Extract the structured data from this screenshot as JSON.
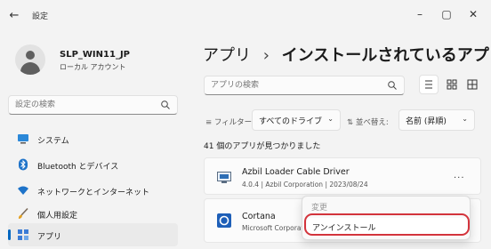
{
  "window": {
    "title": "設定",
    "controls": {
      "minimize": "–",
      "maximize": "▢",
      "close": "✕"
    },
    "back_glyph": "←"
  },
  "profile": {
    "name": "SLP_WIN11_JP",
    "account_type": "ローカル アカウント"
  },
  "sidebar": {
    "search_placeholder": "設定の検索",
    "items": [
      {
        "label": "システム",
        "icon": "monitor-icon"
      },
      {
        "label": "Bluetooth とデバイス",
        "icon": "bluetooth-icon"
      },
      {
        "label": "ネットワークとインターネット",
        "icon": "wifi-icon"
      },
      {
        "label": "個人用設定",
        "icon": "brush-icon"
      },
      {
        "label": "アプリ",
        "icon": "apps-icon",
        "active": true
      }
    ]
  },
  "main": {
    "breadcrumb": {
      "parent": "アプリ",
      "separator": "›",
      "current": "インストールされているアプリ"
    },
    "search_placeholder": "アプリの検索",
    "filter": {
      "label": "フィルター:",
      "value": "すべてのドライブ"
    },
    "sort": {
      "label": "並べ替え:",
      "value": "名前 (昇順)"
    },
    "count": "41 個のアプリが見つかりました",
    "apps": [
      {
        "name": "Azbil Loader Cable Driver",
        "meta": "4.0.4 | Azbil Corporation | 2023/08/24",
        "more": "..."
      },
      {
        "name": "Cortana",
        "meta": "Microsoft Corporati"
      }
    ],
    "context_menu": {
      "items": [
        "変更",
        "アンインストール"
      ],
      "disabled": "変更",
      "highlighted": "アンインストール"
    }
  },
  "colors": {
    "accent": "#0067c0",
    "highlight_ring": "#d3343c"
  }
}
